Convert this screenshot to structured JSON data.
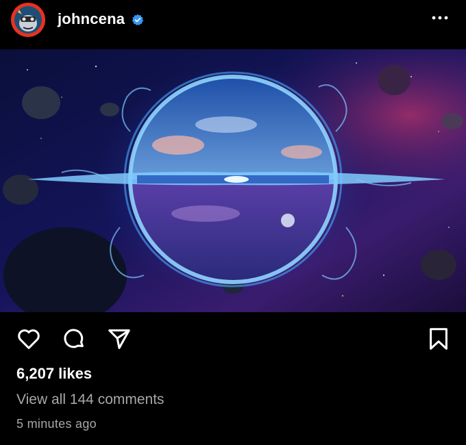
{
  "post": {
    "username": "johncena",
    "verified": true,
    "likes_text": "6,207 likes",
    "comments_text": "View all 144 comments",
    "timestamp": "5 minutes ago"
  },
  "icons": {
    "verified": "verified-badge-icon",
    "more": "more-options-icon",
    "like": "heart-icon",
    "comment": "comment-bubble-icon",
    "share": "paper-plane-icon",
    "save": "bookmark-icon"
  },
  "colors": {
    "background": "#000000",
    "text_primary": "#ffffff",
    "text_secondary": "#a8a8a8",
    "verified_blue": "#3897f0",
    "avatar_ring": "#e8321f"
  }
}
